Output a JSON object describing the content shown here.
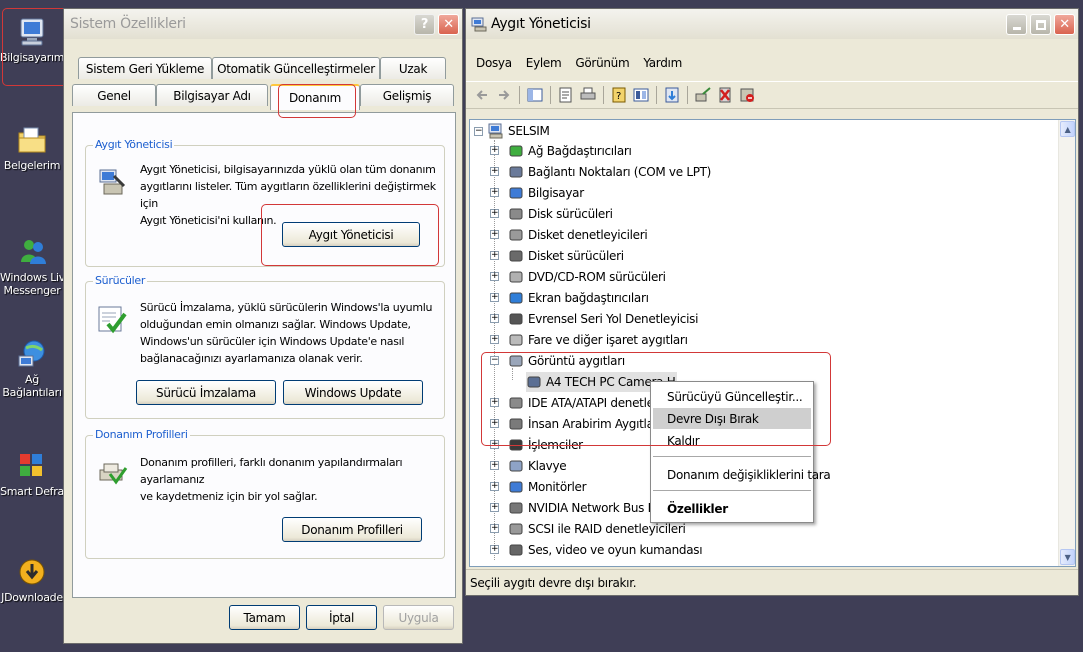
{
  "desktop": {
    "icons": [
      {
        "label": "Bilgisayarım",
        "icon": "my-computer-icon"
      },
      {
        "label": "Belgelerim",
        "icon": "my-documents-icon"
      },
      {
        "label": "Windows Liv",
        "label2": "Messenger",
        "icon": "messenger-icon"
      },
      {
        "label": "Ağ",
        "label2": "Bağlantıları",
        "icon": "network-icon"
      },
      {
        "label": "Smart Defra",
        "icon": "defrag-icon"
      },
      {
        "label": "JDownloade",
        "icon": "jdownloader-icon"
      }
    ]
  },
  "sysprops": {
    "title": "Sistem Özellikleri",
    "help_glyph": "?",
    "close_glyph": "✕",
    "tabs_row1": [
      "Sistem Geri Yükleme",
      "Otomatik Güncelleştirmeler",
      "Uzak"
    ],
    "tabs_row2": [
      "Genel",
      "Bilgisayar Adı",
      "Donanım",
      "Gelişmiş"
    ],
    "active_tab": "Donanım",
    "device_manager_group": {
      "label": "Aygıt Yöneticisi",
      "lines": [
        "Aygıt Yöneticisi, bilgisayarınızda yüklü olan tüm donanım",
        "aygıtlarını listeler. Tüm aygıtların özelliklerini değiştirmek için",
        "Aygıt Yöneticisi'ni kullanın."
      ],
      "button": "Aygıt Yöneticisi"
    },
    "drivers_group": {
      "label": "Sürücüler",
      "lines": [
        "Sürücü İmzalama, yüklü sürücülerin Windows'la uyumlu",
        "olduğundan emin olmanızı sağlar. Windows Update,",
        "Windows'un sürücüler için Windows Update'e nasıl",
        "bağlanacağınızı ayarlamanıza olanak verir."
      ],
      "button_signing": "Sürücü İmzalama",
      "button_update": "Windows Update"
    },
    "profiles_group": {
      "label": "Donanım Profilleri",
      "lines": [
        "Donanım profilleri, farklı donanım yapılandırmaları ayarlamanız",
        "ve kaydetmeniz için bir yol sağlar."
      ],
      "button": "Donanım Profilleri"
    },
    "ok_button": "Tamam",
    "cancel_button": "İptal",
    "apply_button": "Uygula"
  },
  "devmgr": {
    "title": "Aygıt Yöneticisi",
    "menu": [
      "Dosya",
      "Eylem",
      "Görünüm",
      "Yardım"
    ],
    "root": "SELSIM",
    "categories": [
      "Ağ Bağdaştırıcıları",
      "Bağlantı Noktaları (COM ve LPT)",
      "Bilgisayar",
      "Disk sürücüleri",
      "Disket denetleyicileri",
      "Disket sürücüleri",
      "DVD/CD-ROM sürücüleri",
      "Ekran bağdaştırıcıları",
      "Evrensel Seri Yol Denetleyicisi",
      "Fare ve diğer işaret aygıtları",
      "Görüntü aygıtları",
      "A4 TECH PC Camera H",
      "IDE ATA/ATAPI denetleyici",
      "İnsan Arabirim Aygıtları",
      "İşlemciler",
      "Klavye",
      "Monitörler",
      "NVIDIA Network Bus Enum",
      "SCSI ile RAID denetleyicileri",
      "Ses, video ve oyun kumandası"
    ],
    "status": "Seçili aygıtı devre dışı bırakır."
  },
  "context_menu": {
    "items": [
      "Sürücüyü Güncelleştir...",
      "Devre Dışı Bırak",
      "Kaldır",
      "Donanım değişikliklerini tara",
      "Özellikler"
    ]
  },
  "colors": {
    "desktop": "#3f3e56",
    "window_face": "#ece9d8",
    "highlight_box": "#d23838",
    "group_label": "#1d5fcf"
  }
}
